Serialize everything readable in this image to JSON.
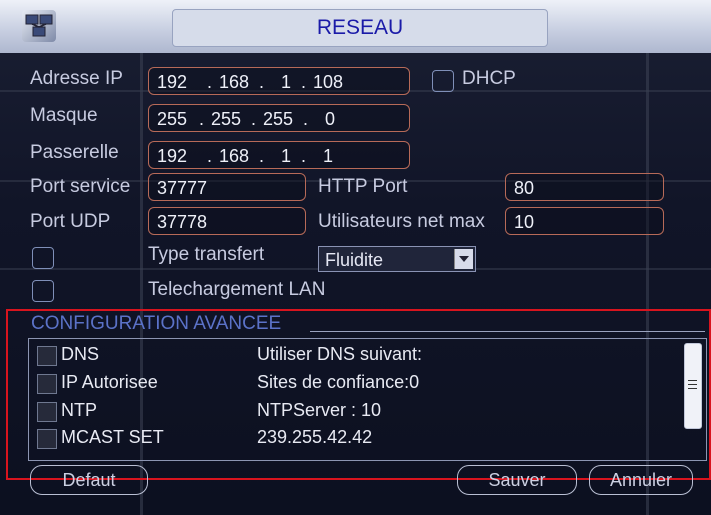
{
  "window": {
    "title": "RESEAU",
    "icon": "network-settings-icon"
  },
  "network": {
    "ip": {
      "label": "Adresse IP",
      "octets": [
        "192",
        "168",
        "1",
        "108"
      ]
    },
    "dhcp": {
      "label": "DHCP",
      "checked": false
    },
    "mask": {
      "label": "Masque",
      "octets": [
        "255",
        "255",
        "255",
        "0"
      ]
    },
    "gateway": {
      "label": "Passerelle",
      "octets": [
        "192",
        "168",
        "1",
        "1"
      ]
    },
    "service_port": {
      "label": "Port service",
      "value": "37777"
    },
    "http_port": {
      "label": "HTTP Port",
      "value": "80"
    },
    "udp_port": {
      "label": "Port UDP",
      "value": "37778"
    },
    "max_users": {
      "label": "Utilisateurs net max",
      "value": "10"
    },
    "transfer_type": {
      "label": "Type transfert",
      "value": "Fluidite",
      "checked": false
    },
    "lan_download": {
      "label": "Telechargement LAN",
      "checked": false
    }
  },
  "advanced": {
    "title": "CONFIGURATION AVANCEE",
    "rows": [
      {
        "name": "DNS",
        "value": "Utiliser DNS suivant:"
      },
      {
        "name": "IP Autorisee",
        "value": "Sites de confiance:0"
      },
      {
        "name": "NTP",
        "value": "NTPServer : 10"
      },
      {
        "name": "MCAST SET",
        "value": "239.255.42.42"
      }
    ]
  },
  "buttons": {
    "default": "Defaut",
    "save": "Sauver",
    "cancel": "Annuler"
  },
  "colors": {
    "title_text": "#1a1aa8",
    "field_border": "#b76a58",
    "highlight_box": "#d8141e",
    "section_title": "#5b72c8"
  }
}
